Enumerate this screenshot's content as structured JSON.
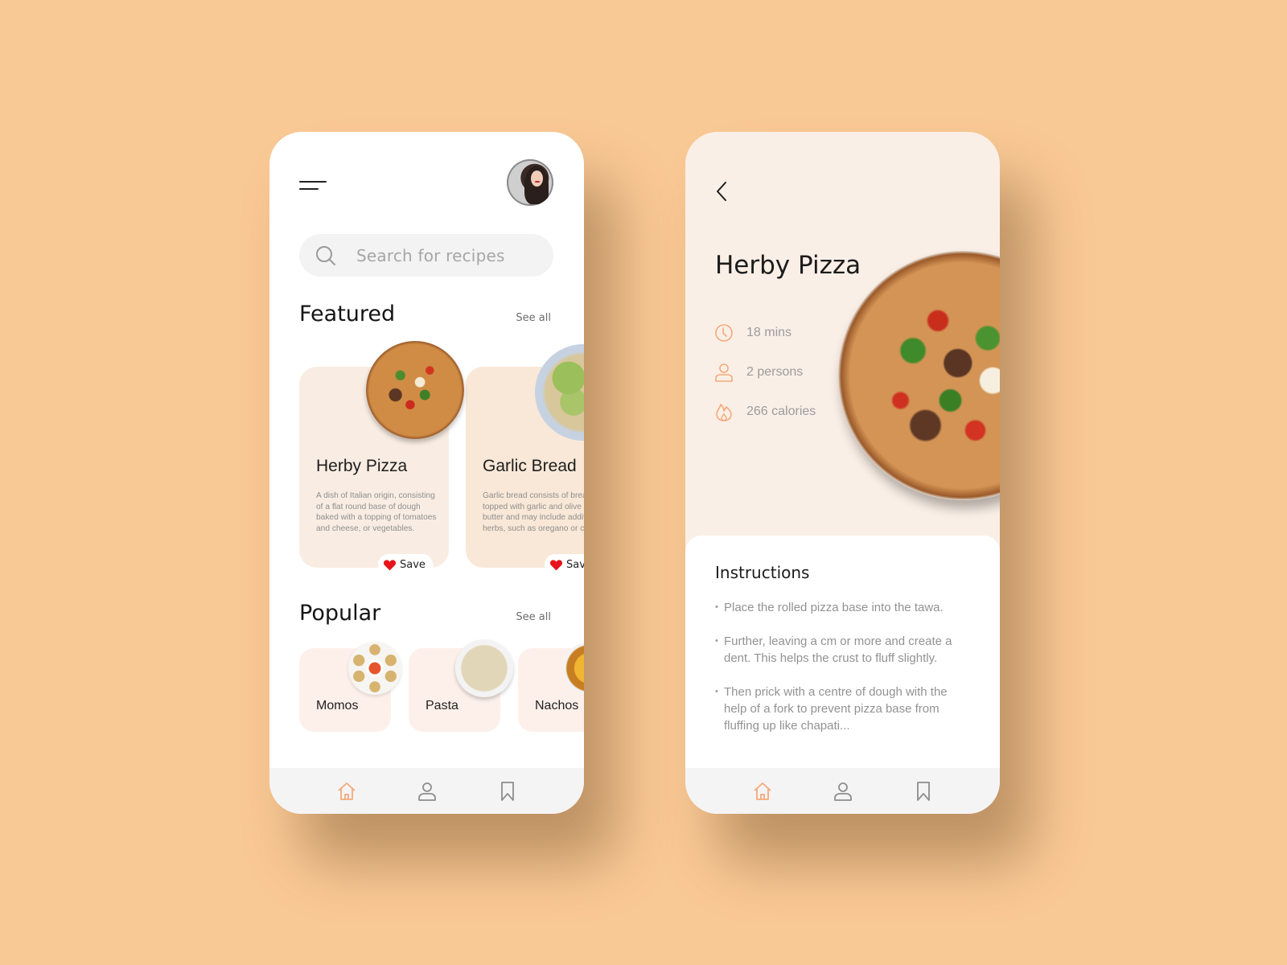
{
  "home_screen": {
    "search": {
      "placeholder": "Search for recipes"
    },
    "featured": {
      "title": "Featured",
      "see_all": "See all",
      "cards": [
        {
          "name": "Herby Pizza",
          "description": "A dish of Italian origin, consisting of a flat round base of dough baked with a topping of tomatoes and cheese, or vegetables.",
          "save_label": "Save"
        },
        {
          "name": "Garlic Bread",
          "description": "Garlic bread consists of bread topped with garlic and olive oil or butter and may include additional herbs, such as oregano or chives.",
          "save_label": "Save"
        }
      ]
    },
    "popular": {
      "title": "Popular",
      "see_all": "See all",
      "items": [
        {
          "name": "Momos"
        },
        {
          "name": "Pasta"
        },
        {
          "name": "Nachos"
        }
      ]
    },
    "nav": {
      "active": "home",
      "items": [
        "home",
        "profile",
        "bookmarks"
      ]
    }
  },
  "detail_screen": {
    "title": "Herby Pizza",
    "meta": [
      {
        "icon": "clock-icon",
        "text": "18 mins"
      },
      {
        "icon": "person-icon",
        "text": "2 persons"
      },
      {
        "icon": "flame-icon",
        "text": "266 calories"
      }
    ],
    "instructions": {
      "heading": "Instructions",
      "steps": [
        "Place the rolled pizza base into the tawa.",
        "Further, leaving a cm or more and create a dent. This helps the crust to fluff slightly.",
        "Then prick with a centre of dough with the help of a fork to prevent pizza base from fluffing up like chapati..."
      ]
    },
    "nav": {
      "active": "home",
      "items": [
        "home",
        "profile",
        "bookmarks"
      ]
    }
  },
  "colors": {
    "background": "#f9c995",
    "accent": "#f5a97a",
    "heart": "#e8141b",
    "card_featured": "#f9ede3",
    "card_popular": "#fdf0ea",
    "detail_bg": "#faefe6"
  }
}
